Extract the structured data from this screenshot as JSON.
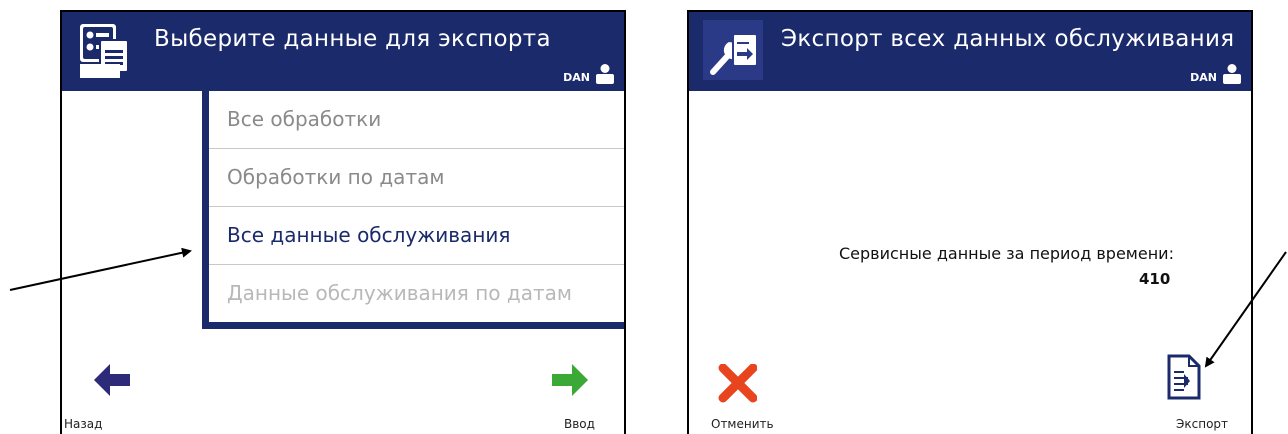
{
  "left_screen": {
    "header": {
      "title": "Выберите данные для экспорта",
      "user": "DAN",
      "icon": "export-data-icon"
    },
    "menu": {
      "items": [
        {
          "label": "Все обработки",
          "state": "normal"
        },
        {
          "label": "Обработки по датам",
          "state": "normal"
        },
        {
          "label": "Все данные обслуживания",
          "state": "selected"
        },
        {
          "label": "Данные обслуживания по датам",
          "state": "disabled"
        }
      ]
    },
    "back_button": {
      "label": "Назад",
      "icon": "arrow-left-icon",
      "color": "#2e2a7a"
    },
    "enter_button": {
      "label": "Ввод",
      "icon": "arrow-right-icon",
      "color": "#3aa935"
    }
  },
  "right_screen": {
    "header": {
      "title": "Экспорт всех данных обслуживания",
      "user": "DAN",
      "icon": "wrench-document-icon"
    },
    "service_data": {
      "label": "Сервисные данные за период времени:",
      "value": "410"
    },
    "cancel_button": {
      "label": "Отменить",
      "icon": "x-icon",
      "color": "#e8441e"
    },
    "export_button": {
      "label": "Экспорт",
      "icon": "document-export-icon"
    }
  },
  "colors": {
    "header_bg": "#1b2a6b",
    "selected_text": "#1b2a6b",
    "muted_text": "#8a8a8a"
  }
}
